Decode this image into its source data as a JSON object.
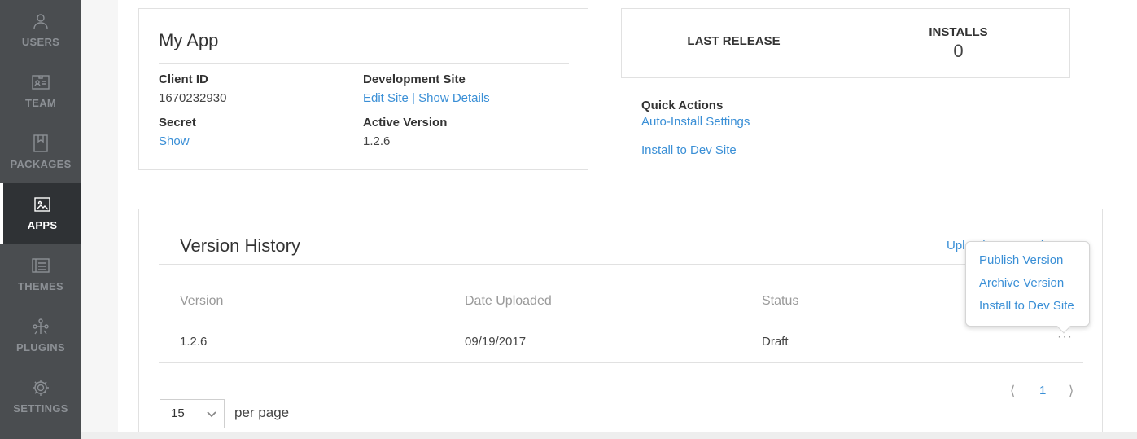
{
  "sidebar": {
    "items": [
      {
        "label": "USERS",
        "icon": "user-icon",
        "active": false
      },
      {
        "label": "TEAM",
        "icon": "id-card-icon",
        "active": false
      },
      {
        "label": "PACKAGES",
        "icon": "package-icon",
        "active": false
      },
      {
        "label": "APPS",
        "icon": "image-icon",
        "active": true
      },
      {
        "label": "THEMES",
        "icon": "theme-icon",
        "active": false
      },
      {
        "label": "PLUGINS",
        "icon": "plugin-icon",
        "active": false
      },
      {
        "label": "SETTINGS",
        "icon": "gear-icon",
        "active": false
      }
    ]
  },
  "app": {
    "title": "My App",
    "client_id_label": "Client ID",
    "client_id": "1670232930",
    "secret_label": "Secret",
    "secret_link": "Show",
    "dev_site_label": "Development Site",
    "edit_site_link": "Edit Site",
    "separator": "|",
    "show_details_link": "Show Details",
    "active_version_label": "Active Version",
    "active_version": "1.2.6"
  },
  "stats": {
    "last_release_label": "LAST RELEASE",
    "installs_label": "INSTALLS",
    "installs_value": "0"
  },
  "quick_actions": {
    "title": "Quick Actions",
    "auto_install": "Auto-Install Settings",
    "install_dev": "Install to Dev Site"
  },
  "version_history": {
    "title": "Version History",
    "upload_link": "Upload New Version",
    "columns": [
      "Version",
      "Date Uploaded",
      "Status"
    ],
    "rows": [
      {
        "version": "1.2.6",
        "date": "09/19/2017",
        "status": "Draft"
      }
    ],
    "row_menu": "···",
    "pager": {
      "prev": "⟨",
      "page": "1",
      "next": "⟩"
    },
    "per_page_value": "15",
    "per_page_label": "per page"
  },
  "popover": {
    "items": [
      "Publish Version",
      "Archive Version",
      "Install to Dev Site"
    ]
  },
  "colors": {
    "sidebar_bg": "#4a4d50",
    "sidebar_active_bg": "#2f3235",
    "link": "#3a8fd6"
  }
}
